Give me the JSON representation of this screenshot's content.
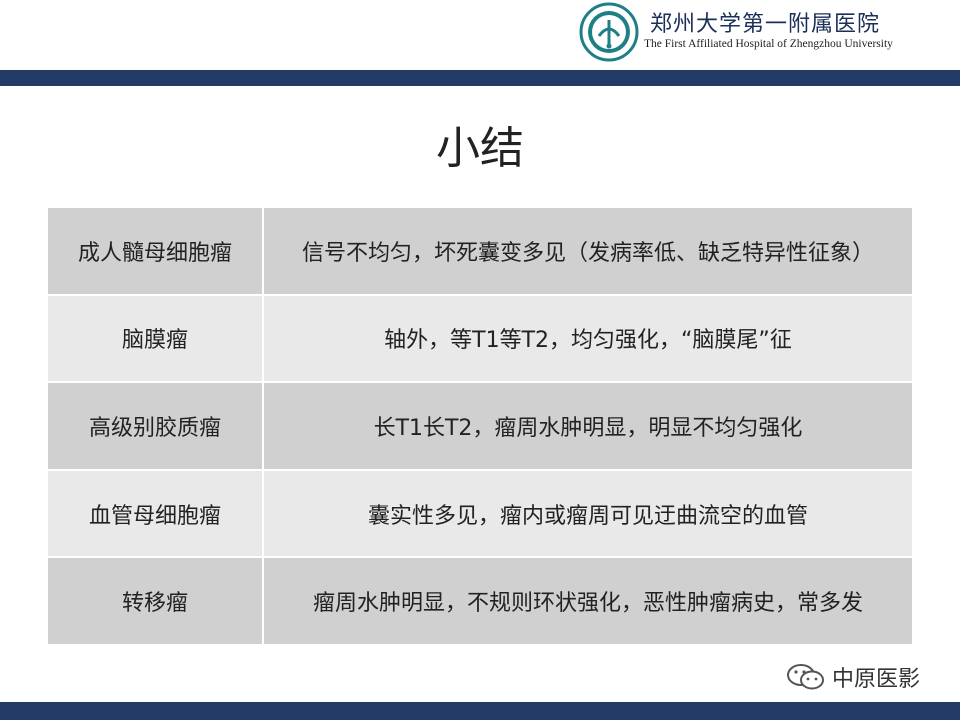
{
  "header": {
    "hospital_name_cn": "郑州大学第一附属医院",
    "hospital_name_en": "The First Affiliated Hospital of Zhengzhou University",
    "logo_icon": "hospital-logo-icon"
  },
  "title": "小结",
  "table": {
    "rows": [
      {
        "name": "成人髓母细胞瘤",
        "desc": "信号不均匀，坏死囊变多见（发病率低、缺乏特异性征象）"
      },
      {
        "name": "脑膜瘤",
        "desc": "轴外，等T1等T2，均匀强化，“脑膜尾”征"
      },
      {
        "name": "高级别胶质瘤",
        "desc": "长T1长T2，瘤周水肿明显，明显不均匀强化"
      },
      {
        "name": "血管母细胞瘤",
        "desc": "囊实性多见，瘤内或瘤周可见迂曲流空的血管"
      },
      {
        "name": "转移瘤",
        "desc": "瘤周水肿明显，不规则环状强化，恶性肿瘤病史，常多发"
      }
    ]
  },
  "footer": {
    "watermark": "中原医影",
    "icon": "wechat-icon"
  },
  "colors": {
    "brand_navy": "#243b67",
    "row_dark": "#d0d0d0",
    "row_light": "#e9e9e9",
    "logo_teal": "#1f7f86"
  }
}
